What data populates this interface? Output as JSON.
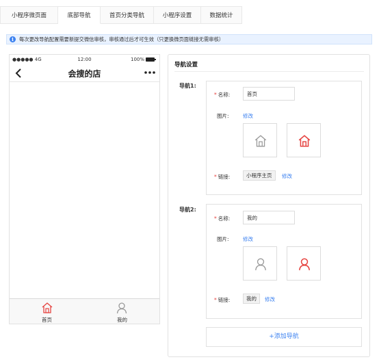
{
  "tabs": [
    {
      "label": "小程序微页面"
    },
    {
      "label": "底部导航"
    },
    {
      "label": "首页分类导航"
    },
    {
      "label": "小程序设置"
    },
    {
      "label": "数据统计"
    }
  ],
  "active_tab": 1,
  "notice": {
    "text": "每次更改导航配置需要新提交微信审核，审核通过后才可生效（只更换微页面链接无需审核）"
  },
  "phone": {
    "status": {
      "carrier": "●●●●● 4G",
      "time": "12:00",
      "battery": "100%"
    },
    "title": "会搜的店",
    "tabbar": [
      {
        "label": "首页",
        "icon": "home-icon"
      },
      {
        "label": "我的",
        "icon": "user-icon"
      }
    ]
  },
  "settings": {
    "title": "导航设置",
    "navs": [
      {
        "label": "导航1:",
        "name_label": "名称:",
        "name_value": "首页",
        "image_label": "图片:",
        "image_edit": "修改",
        "link_label": "链接:",
        "link_value": "小程序主页",
        "link_edit": "修改",
        "icon": "home-icon"
      },
      {
        "label": "导航2:",
        "name_label": "名称:",
        "name_value": "我的",
        "image_label": "图片:",
        "image_edit": "修改",
        "link_label": "链接:",
        "link_value": "我的",
        "link_edit": "修改",
        "icon": "user-icon"
      }
    ],
    "add_button": "+添加导航"
  },
  "colors": {
    "accent": "#3d82f0",
    "active_icon": "#e64340",
    "inactive_icon": "#999999",
    "notice_bg": "#e9f2ff"
  }
}
